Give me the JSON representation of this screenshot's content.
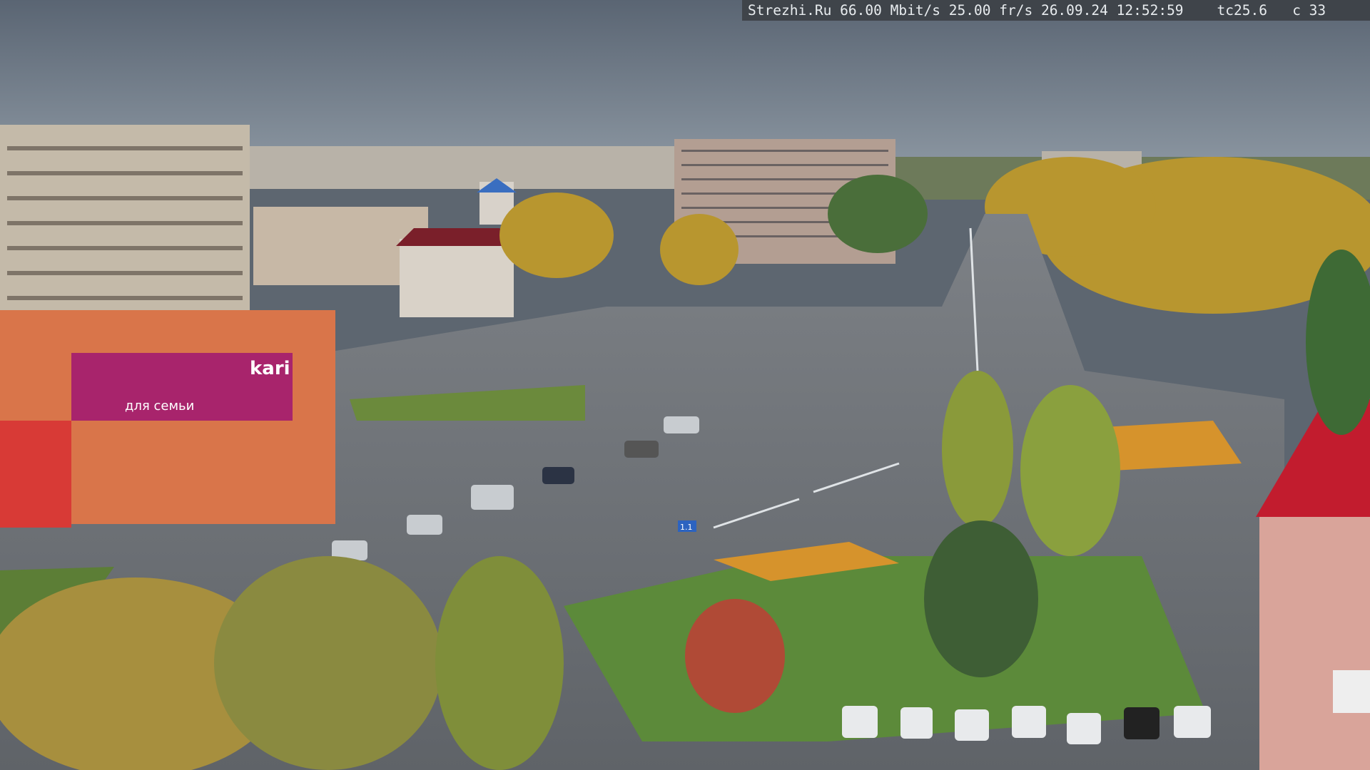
{
  "osd": {
    "site": "Strezhi.Ru",
    "bitrate": "66.00 Mbit/s",
    "framerate": "25.00 fr/s",
    "date": "26.09.24",
    "time": "12:52:59",
    "temp": "tc25.6",
    "extra": "c 33"
  },
  "signs": {
    "store_brand": "kari",
    "store_slogan": "для семьи",
    "road_sign": "1.1"
  },
  "colors": {
    "sky": "#6e7a88",
    "asphalt": "#6a6e73",
    "grass": "#5c8a3a",
    "autumn_foliage": "#c9a23a",
    "store_sign": "#a8246c"
  }
}
